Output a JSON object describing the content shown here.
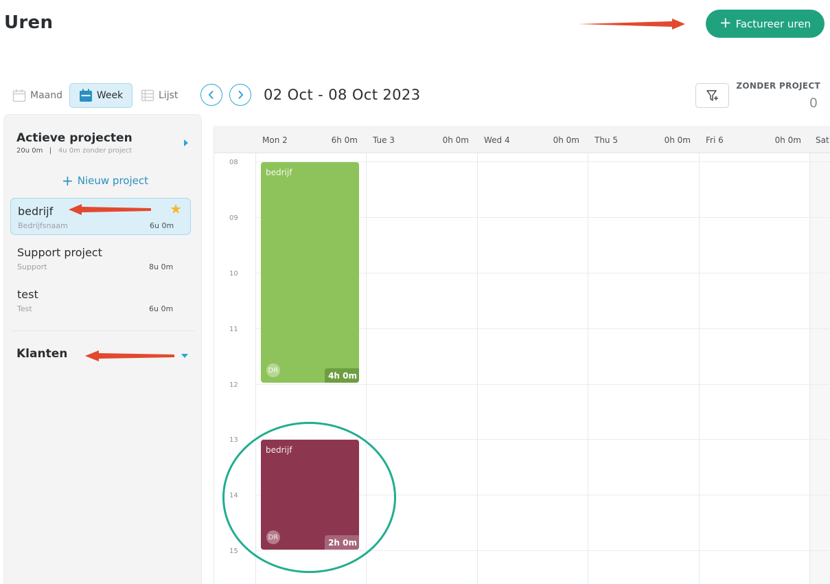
{
  "header": {
    "title": "Uren",
    "invoice_button": "Factureer uren",
    "invoice_plus": "+"
  },
  "toolbar": {
    "views": {
      "month": "Maand",
      "week": "Week",
      "list": "Lijst"
    },
    "prev": "‹",
    "next": "›",
    "date_range": "02 Oct - 08 Oct 2023",
    "no_project_label": "ZONDER PROJECT",
    "no_project_count": "0"
  },
  "sidebar": {
    "title": "Actieve projecten",
    "total": "20u 0m",
    "separator": "|",
    "without_project": "4u 0m zonder project",
    "new_project": "Nieuw project",
    "new_project_plus": "+",
    "projects": [
      {
        "name": "bedrijf",
        "client": "Bedrijfsnaam",
        "hours": "6u 0m",
        "starred": true
      },
      {
        "name": "Support project",
        "client": "Support",
        "hours": "8u 0m",
        "starred": false
      },
      {
        "name": "test",
        "client": "Test",
        "hours": "6u 0m",
        "starred": false
      }
    ],
    "star": "★",
    "clients_title": "Klanten"
  },
  "calendar": {
    "days": [
      {
        "name": "Mon 2",
        "hours": "6h 0m"
      },
      {
        "name": "Tue 3",
        "hours": "0h 0m"
      },
      {
        "name": "Wed 4",
        "hours": "0h 0m"
      },
      {
        "name": "Thu 5",
        "hours": "0h 0m"
      },
      {
        "name": "Fri 6",
        "hours": "0h 0m"
      },
      {
        "name": "Sat",
        "hours": ""
      }
    ],
    "hours": [
      "08",
      "09",
      "10",
      "11",
      "12",
      "13",
      "14",
      "15"
    ],
    "events": [
      {
        "name": "bedrijf",
        "initials": "DR",
        "duration": "4h 0m",
        "color": "#8dc35a",
        "tag_color": "#6e9e42"
      },
      {
        "name": "bedrijf",
        "initials": "DR",
        "duration": "2h 0m",
        "color": "#8c3650",
        "tag_color": "#a66679"
      }
    ]
  },
  "colors": {
    "accent": "#21a27f",
    "link": "#2aa6d6",
    "arrow": "#e2492f",
    "highlight_ring": "#20ad8e"
  }
}
